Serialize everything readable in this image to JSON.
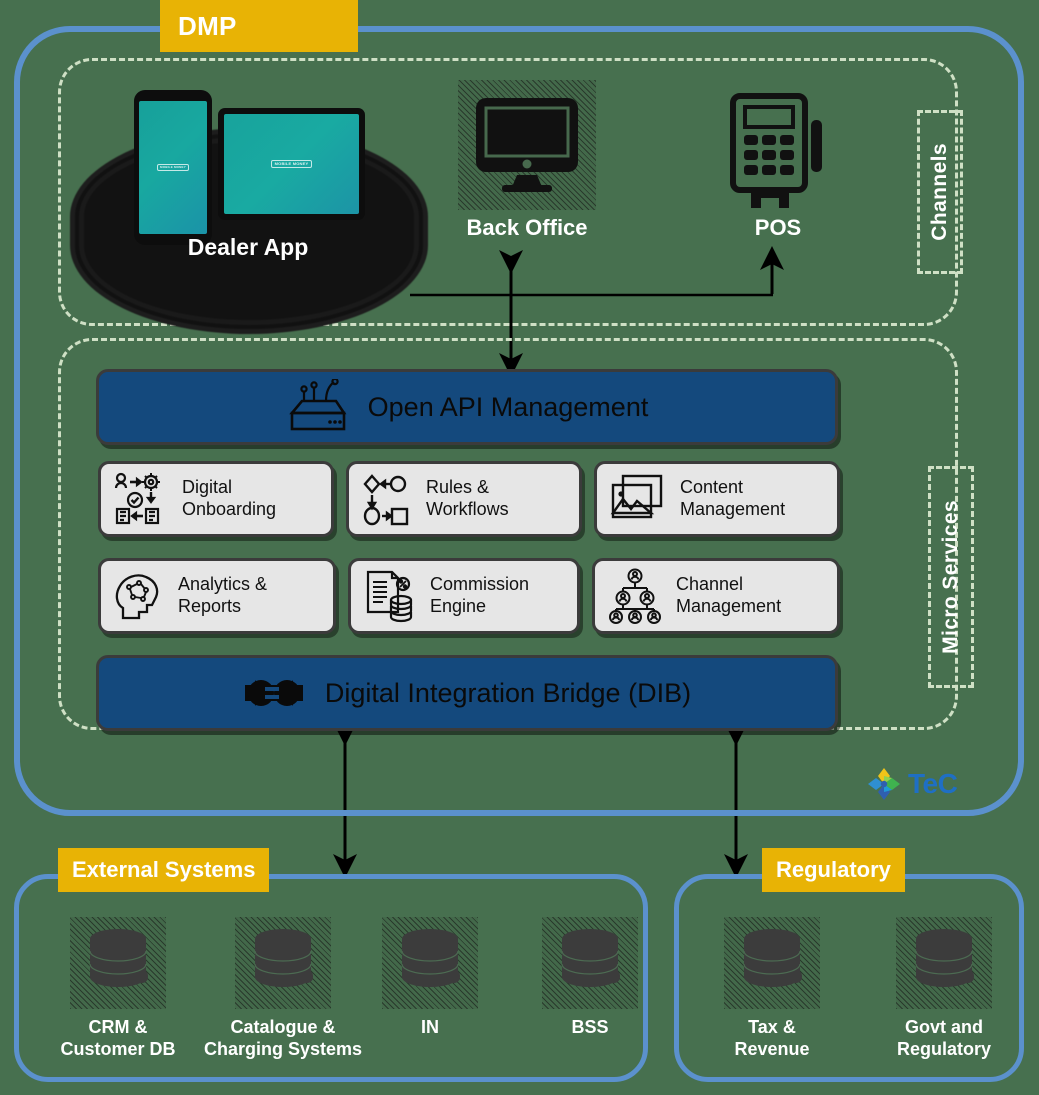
{
  "colors": {
    "background": "#47704f",
    "border_blue": "#5b91cd",
    "tag_yellow": "#e8b305",
    "bar_blue": "#14497d",
    "card_gray": "#e6e6e6",
    "dashed_green": "#cfe0c5",
    "screen_teal": "#18a39c",
    "tec_blue": "#1f6fc4"
  },
  "dmp": {
    "tag_label": "DMP",
    "channels_label": "Channels",
    "micro_services_label": "Micro Services"
  },
  "channels": [
    {
      "id": "dealer-app",
      "label": "Dealer App",
      "icon": "phone-tablet-icon",
      "screen_logo": "MOBILE MONEY"
    },
    {
      "id": "back-office",
      "label": "Back Office",
      "icon": "desktop-monitor-icon"
    },
    {
      "id": "pos",
      "label": "POS",
      "icon": "pos-terminal-icon"
    }
  ],
  "api_bar": {
    "label": "Open API Management",
    "icon": "api-gateway-icon"
  },
  "dib_bar": {
    "label": "Digital Integration Bridge (DIB)",
    "icon": "plug-connector-icon"
  },
  "micro_services": [
    {
      "id": "digital-onboarding",
      "label": "Digital\nOnboarding",
      "icon": "onboarding-flow-icon"
    },
    {
      "id": "rules-workflows",
      "label": "Rules &\nWorkflows",
      "icon": "workflow-nodes-icon"
    },
    {
      "id": "content-management",
      "label": "Content\nManagement",
      "icon": "images-stack-icon"
    },
    {
      "id": "analytics-reports",
      "label": "Analytics &\nReports",
      "icon": "brain-head-icon"
    },
    {
      "id": "commission-engine",
      "label": "Commission\nEngine",
      "icon": "invoice-coins-icon"
    },
    {
      "id": "channel-management",
      "label": "Channel\nManagement",
      "icon": "org-network-icon"
    }
  ],
  "external_systems": {
    "tag_label": "External Systems",
    "items": [
      {
        "id": "crm-customer-db",
        "label": "CRM &\nCustomer DB",
        "icon": "database-icon"
      },
      {
        "id": "catalogue-charging",
        "label": "Catalogue &\nCharging Systems",
        "icon": "database-icon"
      },
      {
        "id": "in",
        "label": "IN",
        "icon": "database-icon"
      },
      {
        "id": "bss",
        "label": "BSS",
        "icon": "database-icon"
      }
    ]
  },
  "regulatory": {
    "tag_label": "Regulatory",
    "items": [
      {
        "id": "tax-revenue",
        "label": "Tax &\nRevenue",
        "icon": "database-icon"
      },
      {
        "id": "govt-regulatory",
        "label": "Govt and\nRegulatory",
        "icon": "database-icon"
      }
    ]
  },
  "branding": {
    "logo_text": "TeC",
    "logo_mark": "pinwheel-cross-icon"
  },
  "connectors": [
    {
      "id": "backoffice-api-link",
      "type": "double-arrow-vertical"
    },
    {
      "id": "pos-api-link",
      "type": "arrow-up-with-elbow"
    },
    {
      "id": "dib-external-link",
      "type": "double-arrow-vertical"
    },
    {
      "id": "dib-regulatory-link",
      "type": "double-arrow-vertical"
    }
  ]
}
